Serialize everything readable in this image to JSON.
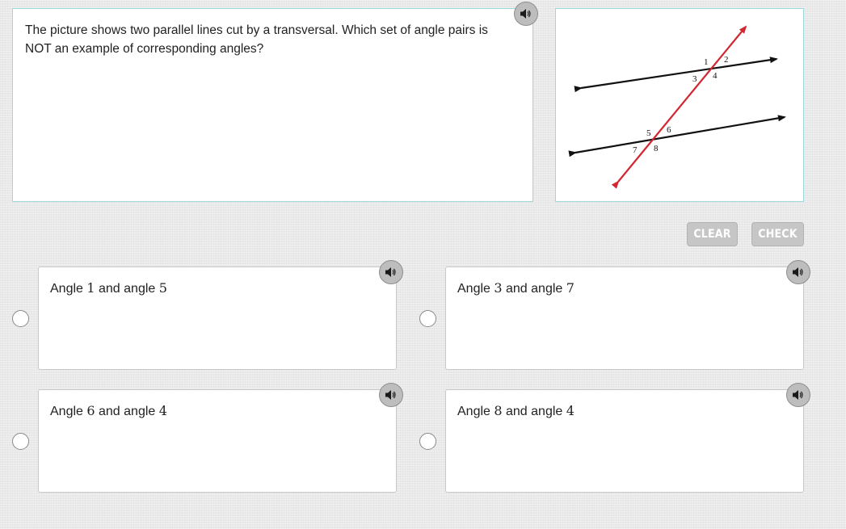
{
  "question": {
    "text": "The picture shows two parallel lines cut by a transversal. Which set of angle pairs is NOT an example of corresponding angles?"
  },
  "figure": {
    "labels": [
      "1",
      "2",
      "3",
      "4",
      "5",
      "6",
      "7",
      "8"
    ],
    "line_color": "#111111",
    "transversal_color": "#d22630"
  },
  "buttons": {
    "clear_label": "CLEAR",
    "check_label": "CHECK"
  },
  "choices": [
    {
      "prefix": "Angle ",
      "a": "1",
      "mid": " and angle ",
      "b": "5"
    },
    {
      "prefix": "Angle ",
      "a": "3",
      "mid": " and angle ",
      "b": "7"
    },
    {
      "prefix": "Angle ",
      "a": "6",
      "mid": " and angle ",
      "b": "4"
    },
    {
      "prefix": "Angle ",
      "a": "8",
      "mid": " and angle ",
      "b": "4"
    }
  ],
  "icons": {
    "audio": "speaker-icon",
    "radio": "radio-circle"
  }
}
